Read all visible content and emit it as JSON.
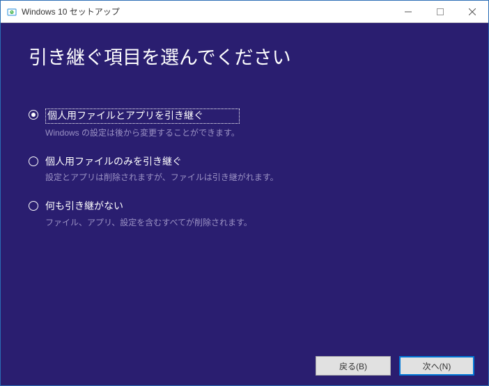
{
  "window": {
    "title": "Windows 10 セットアップ"
  },
  "heading": "引き継ぐ項目を選んでください",
  "options": [
    {
      "label": "個人用ファイルとアプリを引き継ぐ",
      "desc": "Windows の設定は後から変更することができます。",
      "selected": true
    },
    {
      "label": "個人用ファイルのみを引き継ぐ",
      "desc": "設定とアプリは削除されますが、ファイルは引き継がれます。",
      "selected": false
    },
    {
      "label": "何も引き継がない",
      "desc": "ファイル、アプリ、設定を含むすべてが削除されます。",
      "selected": false
    }
  ],
  "buttons": {
    "back": "戻る(B)",
    "next": "次へ(N)"
  }
}
